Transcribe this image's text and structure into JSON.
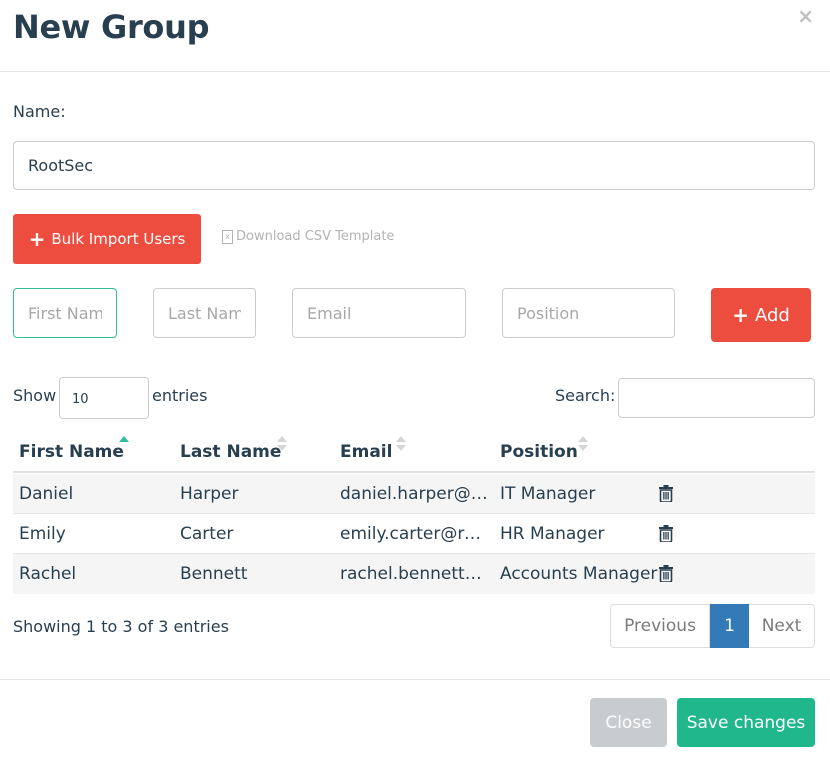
{
  "modal": {
    "title": "New Group",
    "close_glyph": "×"
  },
  "form": {
    "name_label": "Name:",
    "name_value": "RootSec",
    "bulk_import_label": "Bulk Import Users",
    "download_csv_label": "Download CSV Template",
    "first_name_placeholder": "First Name",
    "last_name_placeholder": "Last Name",
    "email_placeholder": "Email",
    "position_placeholder": "Position",
    "add_label": "Add"
  },
  "table_controls": {
    "show_label": "Show",
    "entries_value": "10",
    "entries_label": "entries",
    "search_label": "Search:",
    "search_value": ""
  },
  "table": {
    "columns": [
      "First Name",
      "Last Name",
      "Email",
      "Position"
    ],
    "sorted_column": "First Name",
    "rows": [
      {
        "first": "Daniel",
        "last": "Harper",
        "email": "daniel.harper@rootsec.com",
        "position": "IT Manager"
      },
      {
        "first": "Emily",
        "last": "Carter",
        "email": "emily.carter@rootsec.com",
        "position": "HR Manager"
      },
      {
        "first": "Rachel",
        "last": "Bennett",
        "email": "rachel.bennett@rootsec.com",
        "position": "Accounts Manager"
      }
    ]
  },
  "pagination": {
    "info": "Showing 1 to 3 of 3 entries",
    "previous_label": "Previous",
    "current_page": "1",
    "next_label": "Next"
  },
  "footer": {
    "close_label": "Close",
    "save_label": "Save changes"
  },
  "icons": {
    "plus": "plus-icon",
    "csv": "excel-file-icon",
    "trash": "trash-icon",
    "sort": "sort-icon"
  },
  "colors": {
    "danger": "#ec4d3f",
    "success": "#20b78c",
    "primary": "#337ab7",
    "text": "#283f50",
    "focus": "#2fbf9a"
  }
}
